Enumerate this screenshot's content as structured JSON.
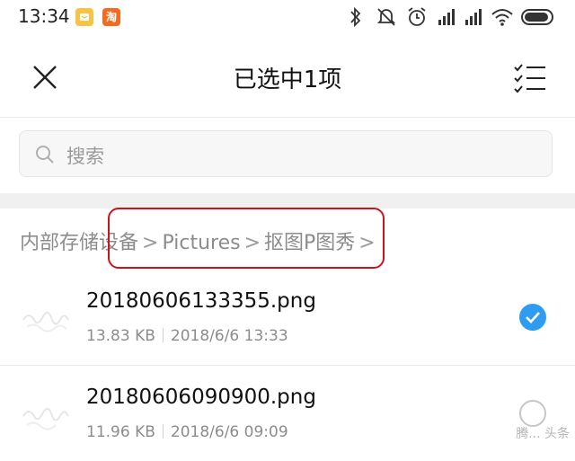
{
  "status_bar": {
    "time": "13:34",
    "taobao_icon_text": "淘"
  },
  "header": {
    "title": "已选中1项"
  },
  "search": {
    "placeholder": "搜索"
  },
  "breadcrumb": [
    "内部存储设备",
    "Pictures",
    "抠图P图秀"
  ],
  "breadcrumb_separator": ">",
  "files": [
    {
      "name": "20180606133355.png",
      "size": "13.83 KB",
      "date": "2018/6/6 13:33",
      "selected": true
    },
    {
      "name": "20180606090900.png",
      "size": "11.96 KB",
      "date": "2018/6/6 09:09",
      "selected": false
    }
  ],
  "colors": {
    "accent": "#2f9cf2",
    "highlight_border": "#c8141e"
  },
  "watermark": "腾... 头条"
}
